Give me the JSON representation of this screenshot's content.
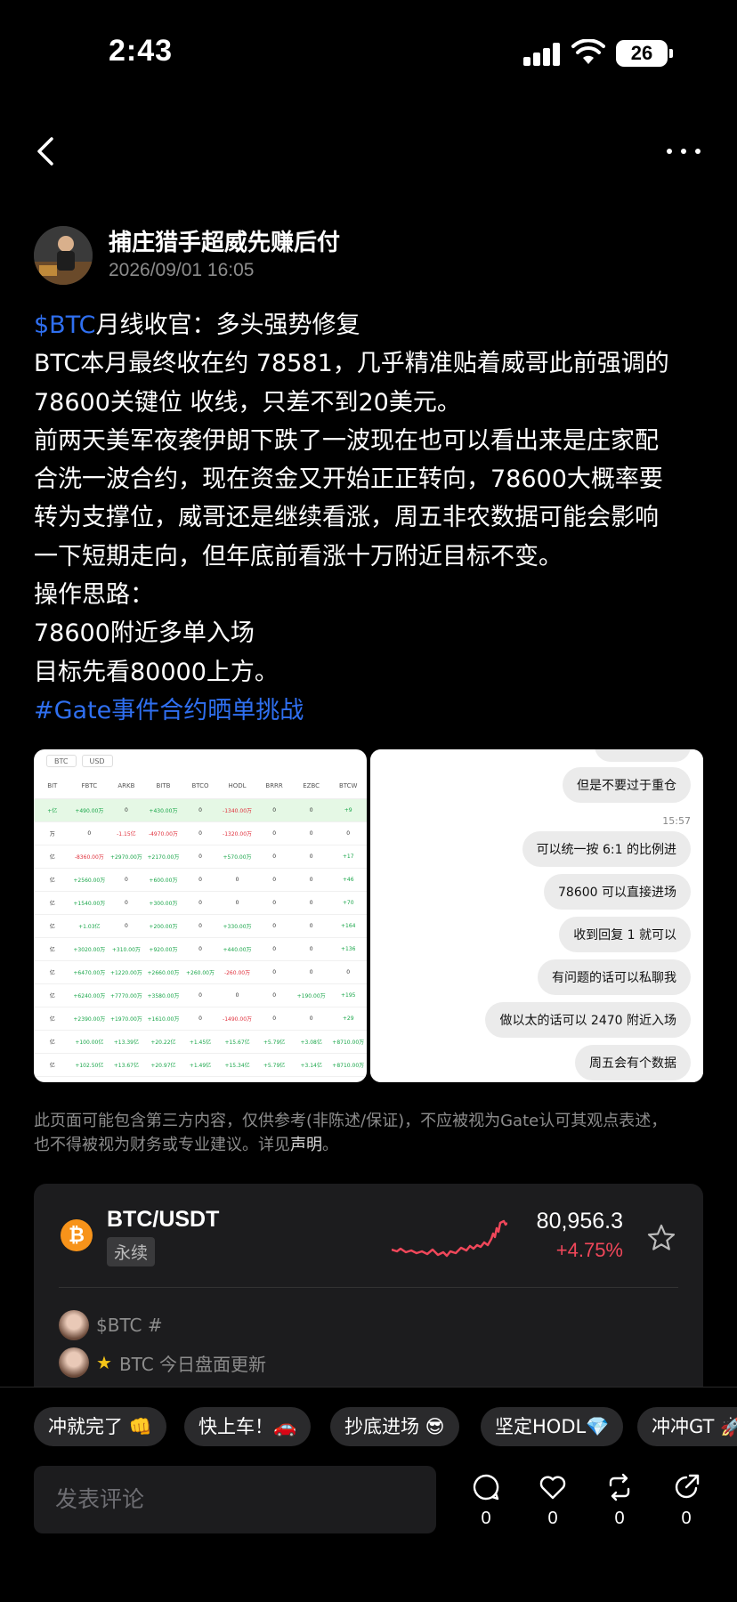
{
  "status_bar": {
    "time": "2:43",
    "battery": "26"
  },
  "author": {
    "name": "捕庄猎手超威先赚后付",
    "time": "2026/09/01 16:05"
  },
  "post": {
    "line1_tag": "$BTC",
    "line1_text": "月线收官：多头强势修复",
    "line2": "BTC本月最终收在约 78581，几乎精准贴着威哥此前强调的",
    "line3": "78600关键位 收线，只差不到20美元。",
    "line4": "前两天美军夜袭伊朗下跌了一波现在也可以看出来是庄家配",
    "line5": "合洗一波合约，现在资金又开始正正转向，78600大概率要",
    "line6": "转为支撑位，威哥还是继续看涨，周五非农数据可能会影响",
    "line7": "一下短期走向，但年底前看涨十万附近目标不变。",
    "line8": "操作思路：",
    "line9": "78600附近多单入场",
    "line10": "目标先看80000上方。",
    "hashtag": "#Gate事件合约晒单挑战"
  },
  "table_image": {
    "tabs": [
      "BTC",
      "USD"
    ],
    "headers": [
      "BIT",
      "FBTC",
      "ARKB",
      "BITB",
      "BTCO",
      "HODL",
      "BRRR",
      "EZBC",
      "BTCW"
    ],
    "rows": [
      [
        "+亿",
        "+490.00万",
        "0",
        "+430.00万",
        "0",
        "-1340.00万",
        "0",
        "0",
        "+9"
      ],
      [
        "万",
        "0",
        "-1.15亿",
        "-4970.00万",
        "0",
        "-1320.00万",
        "0",
        "0",
        "0"
      ],
      [
        "亿",
        "-8360.00万",
        "+2970.00万",
        "+2170.00万",
        "0",
        "+570.00万",
        "0",
        "0",
        "+17"
      ],
      [
        "亿",
        "+2560.00万",
        "0",
        "+600.00万",
        "0",
        "0",
        "0",
        "0",
        "+46"
      ],
      [
        "亿",
        "+1540.00万",
        "0",
        "+300.00万",
        "0",
        "0",
        "0",
        "0",
        "+70"
      ],
      [
        "亿",
        "+1.03亿",
        "0",
        "+200.00万",
        "0",
        "+330.00万",
        "0",
        "0",
        "+164"
      ],
      [
        "亿",
        "+3020.00万",
        "+310.00万",
        "+920.00万",
        "0",
        "+440.00万",
        "0",
        "0",
        "+136"
      ],
      [
        "亿",
        "+6470.00万",
        "+1220.00万",
        "+2660.00万",
        "+260.00万",
        "-260.00万",
        "0",
        "0",
        "0"
      ],
      [
        "亿",
        "+6240.00万",
        "+7770.00万",
        "+3580.00万",
        "0",
        "0",
        "0",
        "+190.00万",
        "+195"
      ],
      [
        "亿",
        "+2390.00万",
        "+1970.00万",
        "+1610.00万",
        "0",
        "-1490.00万",
        "0",
        "0",
        "+29"
      ],
      [
        "亿",
        "+100.00亿",
        "+13.39亿",
        "+20.22亿",
        "+1.45亿",
        "+15.67亿",
        "+5.79亿",
        "+3.08亿",
        "+8710.00万"
      ],
      [
        "亿",
        "+102.50亿",
        "+13.67亿",
        "+20.97亿",
        "+1.49亿",
        "+15.34亿",
        "+5.79亿",
        "+3.14亿",
        "+8710.00万"
      ]
    ]
  },
  "chat_image": {
    "time": "15:57",
    "bubbles": [
      "但是不要过于重仓",
      "可以统一按 6:1 的比例进",
      "78600 可以直接进场",
      "收到回复 1 就可以",
      "有问题的话可以私聊我",
      "做以太的话可以 2470 附近入场",
      "周五会有个数据"
    ]
  },
  "disclaimer": {
    "text1": "此页面可能包含第三方内容，仅供参考(非陈述/保证)，不应被视为Gate认可其观点表述，",
    "text2": "也不得被视为财务或专业建议。详见",
    "link": "声明",
    "end": "。"
  },
  "ticker": {
    "pair": "BTC/USDT",
    "type": "永续",
    "price": "80,956.3",
    "change": "+4.75%",
    "coin_symbol": "₿",
    "accent_up": "#f0475a"
  },
  "related": [
    {
      "text": "$BTC #"
    },
    {
      "star": "★",
      "text": "BTC 今日盘面更新"
    }
  ],
  "quick_replies": [
    "冲就完了 👊",
    "快上车！🚗",
    "抄底进场 😎",
    "坚定HODL💎",
    "冲冲GT 🚀"
  ],
  "comment": {
    "placeholder": "发表评论"
  },
  "actions": {
    "comments": "0",
    "likes": "0",
    "reposts": "0",
    "shares": "0"
  }
}
